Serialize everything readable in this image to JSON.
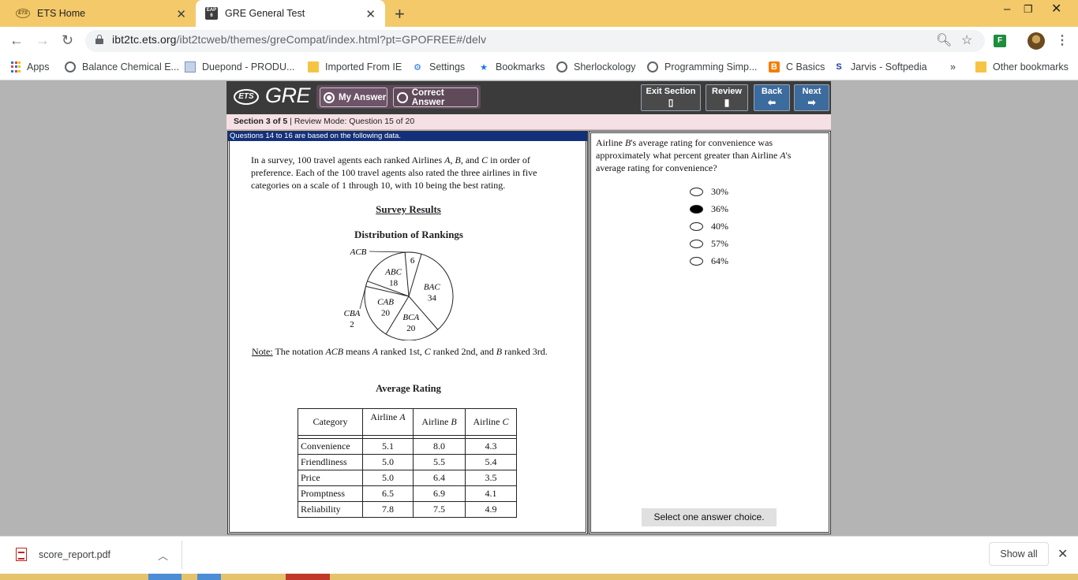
{
  "browser": {
    "tabs": [
      {
        "title": "ETS Home",
        "favicon": "ets-icon",
        "active": false
      },
      {
        "title": "GRE General Test",
        "favicon": "gre-icon",
        "active": true
      }
    ],
    "favicon_text": {
      "ets": "ETS",
      "gre": "EAP 6"
    },
    "url_host": "ibt2tc.ets.org",
    "url_path": "/ibt2tcweb/themes/greCompat/index.html?pt=GPOFREE#/delv",
    "bookmarks": [
      {
        "label": "Apps",
        "icon": "apps-grid-icon"
      },
      {
        "label": "Balance Chemical E...",
        "icon": "globe-icon"
      },
      {
        "label": "Duepond - PRODU...",
        "icon": "document-icon"
      },
      {
        "label": "Imported From IE",
        "icon": "folder-icon"
      },
      {
        "label": "Settings",
        "icon": "gear-icon"
      },
      {
        "label": "Bookmarks",
        "icon": "star-icon"
      },
      {
        "label": "Sherlockology",
        "icon": "globe-icon"
      },
      {
        "label": "Programming Simp...",
        "icon": "globe-icon"
      },
      {
        "label": "C Basics",
        "icon": "blogger-icon"
      },
      {
        "label": "Jarvis - Softpedia",
        "icon": "jarvis-icon"
      }
    ],
    "more_bookmarks": "»",
    "other_bookmarks": "Other bookmarks",
    "blogger_glyph": "B",
    "jarvis_glyph": "S",
    "ext_glyph": "F"
  },
  "gre": {
    "ets_logo": "ETS",
    "title": "GRE",
    "my_answer": "My Answer",
    "correct_answer": "Correct Answer",
    "exit_section": "Exit Section",
    "review": "Review",
    "back": "Back",
    "next": "Next",
    "section_label": "Section 3 of 5",
    "review_mode": " | Review Mode: Question 15 of 20",
    "banner": "Questions 14 to 16 are based on the following data."
  },
  "passage": {
    "intro_1": "In a survey, 100 travel agents each ranked Airlines ",
    "intro_A": "A",
    "intro_sep1": ", ",
    "intro_B": "B",
    "intro_sep2": ", and ",
    "intro_C": "C",
    "intro_2": " in order of preference. Each of the 100 travel agents also rated the three airlines in five categories on a scale of 1 through 10, with 10 being the best rating.",
    "survey_title": "Survey Results",
    "dist_title": "Distribution of Rankings",
    "note_label": "Note:",
    "note_text_1": " The notation ",
    "note_acb": "ACB",
    "note_text_2": " means ",
    "note_a": "A",
    "note_text_3": " ranked 1st, ",
    "note_c": "C",
    "note_text_4": " ranked 2nd, and ",
    "note_b": "B",
    "note_text_5": " ranked 3rd.",
    "avg_title": "Average Rating"
  },
  "chart_data": {
    "type": "pie",
    "title": "Distribution of Rankings",
    "categories": [
      "ACB",
      "BAC",
      "BCA",
      "CAB",
      "CBA",
      "ABC"
    ],
    "values": [
      6,
      34,
      20,
      20,
      2,
      18
    ]
  },
  "table": {
    "headers": [
      "Category",
      "Airline",
      "Airline",
      "Airline"
    ],
    "header_vars": [
      "",
      "A",
      "B",
      "C"
    ],
    "rows": [
      [
        "Convenience",
        "5.1",
        "8.0",
        "4.3"
      ],
      [
        "Friendliness",
        "5.0",
        "5.5",
        "5.4"
      ],
      [
        "Price",
        "5.0",
        "6.4",
        "3.5"
      ],
      [
        "Promptness",
        "6.5",
        "6.9",
        "4.1"
      ],
      [
        "Reliability",
        "7.8",
        "7.5",
        "4.9"
      ]
    ]
  },
  "question": {
    "q1": "Airline ",
    "qB": "B",
    "q2": "'s average rating for convenience was approximately what percent greater than Airline ",
    "qA": "A",
    "q3": "'s average rating for convenience?",
    "choices": [
      "30%",
      "36%",
      "40%",
      "57%",
      "64%"
    ],
    "selected_index": 1,
    "hint": "Select one answer choice."
  },
  "downloads": {
    "file": "score_report.pdf",
    "show_all": "Show all"
  },
  "colors": {
    "tabbar": "#f3c969",
    "gre_header": "#3b3b3b",
    "nav_blue": "#3c6b9e",
    "status_bar": "#f5e1e5",
    "banner": "#13307a"
  }
}
